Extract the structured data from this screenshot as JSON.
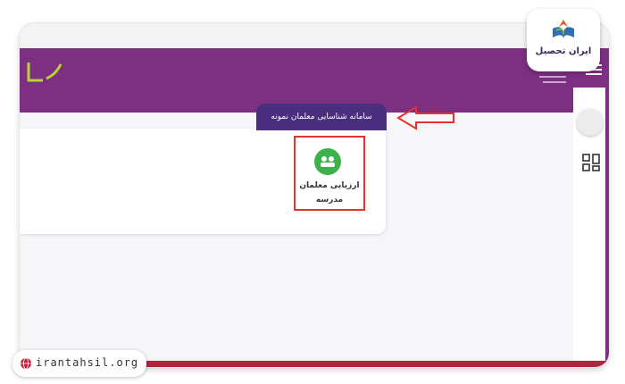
{
  "header": {
    "logo_icon": "brand-logo-icon",
    "menu_icon": "hamburger-menu-icon"
  },
  "tab": {
    "label": "سامانه شناسایی معلمان نمونه"
  },
  "tile": {
    "icon": "users-group-icon",
    "label_line1": "ارزیابی معلمان",
    "label_line2": "مدرسه"
  },
  "sidebar": {
    "avatar_icon": "user-avatar",
    "dashboard_icon": "grid-dashboard-icon"
  },
  "watermark": {
    "brand_text": "ایران تحصیل",
    "site": "irantahsil.org"
  },
  "colors": {
    "purple": "#7d2f82",
    "tab_purple": "#4a2f7e",
    "highlight_red": "#e5322f",
    "green": "#3db24a"
  }
}
